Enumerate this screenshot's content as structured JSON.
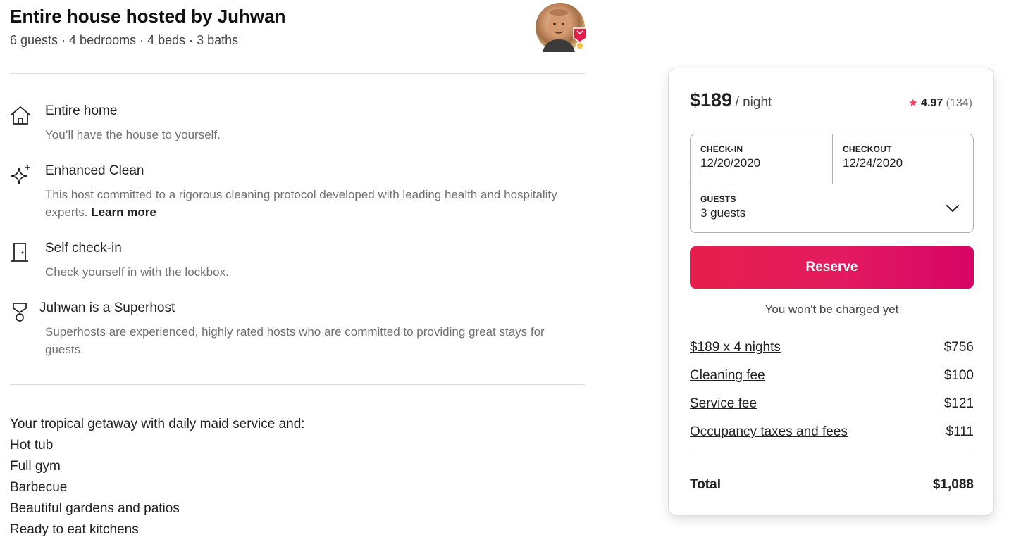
{
  "listing": {
    "title": "Entire house hosted by Juhwan",
    "subtitle": "6 guests · 4 bedrooms · 4 beds · 3 baths"
  },
  "features": [
    {
      "icon": "home-icon",
      "title": "Entire home",
      "desc": "You’ll have the house to yourself."
    },
    {
      "icon": "sparkle-icon",
      "title": "Enhanced Clean",
      "desc": "This host committed to a rigorous cleaning protocol developed with leading health and hospitality experts.",
      "link": "Learn more"
    },
    {
      "icon": "door-icon",
      "title": "Self check-in",
      "desc": "Check yourself in with the lockbox."
    },
    {
      "icon": "medal-icon",
      "title_name": "Juhwan",
      "title": "is a Superhost",
      "desc": "Superhosts are experienced, highly rated hosts who are committed to providing great stays for guests."
    }
  ],
  "description": {
    "intro": "Your tropical getaway with daily maid service and:",
    "items": [
      "Hot tub",
      "Full gym",
      "Barbecue",
      "Beautiful gardens and patios",
      "Ready to eat kitchens"
    ]
  },
  "booking": {
    "price": "$189",
    "price_unit": "/ night",
    "rating": "4.97",
    "reviews": "(134)",
    "checkin_label": "CHECK-IN",
    "checkin_value": "12/20/2020",
    "checkout_label": "CHECKOUT",
    "checkout_value": "12/24/2020",
    "guests_label": "GUESTS",
    "guests_value": "3 guests",
    "reserve_label": "Reserve",
    "notice": "You won't be charged yet",
    "lines": [
      {
        "label": "$189 x 4 nights",
        "amount": "$756"
      },
      {
        "label": "Cleaning fee",
        "amount": "$100"
      },
      {
        "label": "Service fee",
        "amount": "$121"
      },
      {
        "label": "Occupancy taxes and fees",
        "amount": "$111"
      }
    ],
    "total_label": "Total",
    "total_amount": "$1,088",
    "accent_color": "#e31c5f",
    "star_color": "#ff385c"
  }
}
